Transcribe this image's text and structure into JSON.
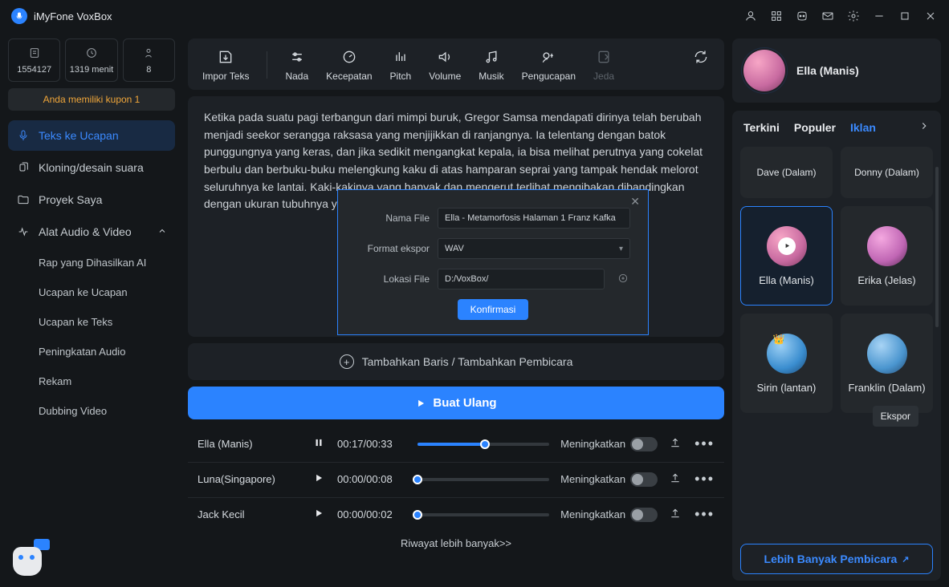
{
  "app": {
    "title": "iMyFone VoxBox"
  },
  "stats": {
    "chars": "1554127",
    "minutes": "1319 menit",
    "count": "8"
  },
  "coupon": "Anda memiliki kupon 1",
  "nav": {
    "tts": "Teks ke Ucapan",
    "clone": "Kloning/desain suara",
    "projects": "Proyek Saya",
    "tools": "Alat Audio & Video",
    "subs": {
      "rap": "Rap yang Dihasilkan AI",
      "s2s": "Ucapan ke Ucapan",
      "s2t": "Ucapan ke Teks",
      "enhance": "Peningkatan Audio",
      "record": "Rekam",
      "dub": "Dubbing Video"
    }
  },
  "toolbar": {
    "import": "Impor Teks",
    "tone": "Nada",
    "speed": "Kecepatan",
    "pitch": "Pitch",
    "volume": "Volume",
    "music": "Musik",
    "pron": "Pengucapan",
    "pause": "Jeda"
  },
  "text_content": "Ketika pada suatu pagi terbangun dari mimpi buruk, Gregor Samsa mendapati dirinya telah berubah menjadi seekor serangga raksasa yang menjijikkan di ranjangnya. Ia telentang dengan batok punggungnya yang keras, dan jika sedikit mengangkat kepala, ia bisa melihat perutnya yang cokelat berbulu dan berbuku-buku melengkung kaku di atas hamparan seprai yang tampak hendak melorot seluruhnya ke lantai. Kaki-kakinya yang banyak dan mengerut terlihat mengibakan dibandingkan dengan ukuran tubuhnya yang lain.",
  "addrow": "Tambahkan Baris / Tambahkan Pembicara",
  "regen": "Buat Ulang",
  "tracks": [
    {
      "name": "Ella (Manis)",
      "time": "00:17/00:33",
      "playing": true,
      "progress": 51
    },
    {
      "name": "Luna(Singapore)",
      "time": "00:00/00:08",
      "playing": false,
      "progress": 0
    },
    {
      "name": "Jack Kecil",
      "time": "00:00/00:02",
      "playing": false,
      "progress": 0
    }
  ],
  "enhance_label": "Meningkatkan",
  "more_history": "Riwayat lebih banyak>>",
  "voice_header": {
    "name": "Ella (Manis)"
  },
  "voice_tabs": {
    "recent": "Terkini",
    "popular": "Populer",
    "iklan": "Iklan"
  },
  "voices": {
    "dave": "Dave (Dalam)",
    "donny": "Donny (Dalam)",
    "ella": "Ella (Manis)",
    "erika": "Erika (Jelas)",
    "sirin": "Sirin (lantan)",
    "franklin": "Franklin (Dalam)"
  },
  "more_voices": "Lebih Banyak Pembicara",
  "modal": {
    "file_label": "Nama File",
    "file_value": "Ella - Metamorfosis Halaman 1 Franz Kafka",
    "format_label": "Format ekspor",
    "format_value": "WAV",
    "loc_label": "Lokasi File",
    "loc_value": "D:/VoxBox/",
    "confirm": "Konfirmasi"
  },
  "tooltip_export": "Ekspor"
}
